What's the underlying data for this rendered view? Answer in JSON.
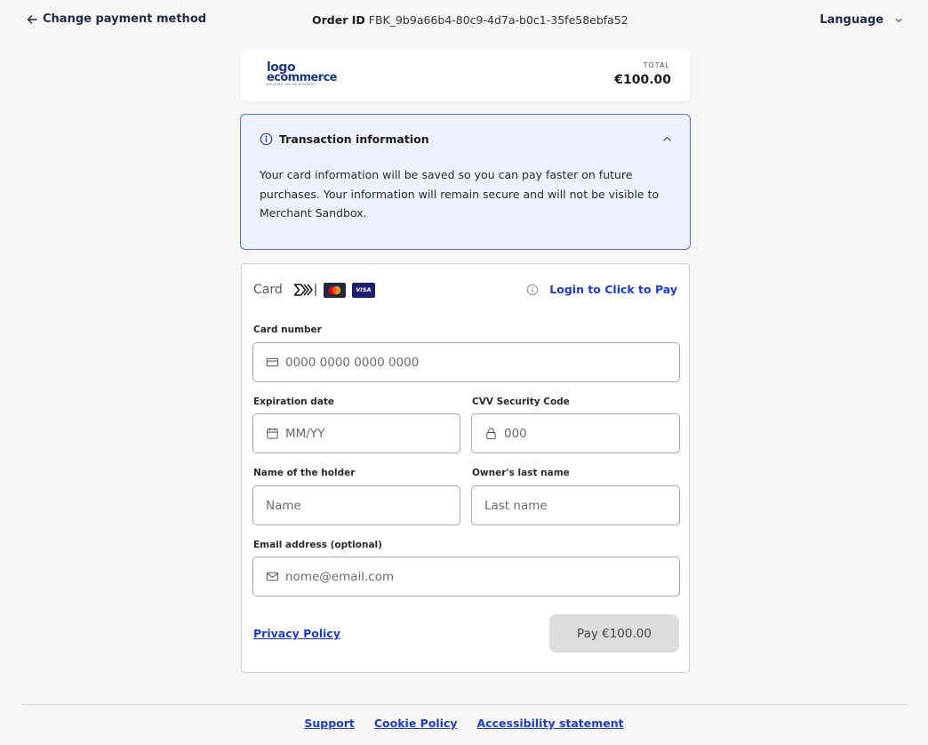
{
  "header": {
    "back_label": "Change payment method",
    "order_label": "Order ID",
    "order_id": "FBK_9b9a66b4-80c9-4d7a-b0c1-35fe58ebfa52",
    "language_label": "Language"
  },
  "merchant": {
    "logo_line1": "logo",
    "logo_line2": "ecommerce",
    "logo_tagline": "BUILDING ONLINE BUSINESS",
    "total_label": "TOTAL",
    "total_value": "€100.00"
  },
  "transaction_info": {
    "title": "Transaction information",
    "body": "Your card information will be saved so you can pay faster on future purchases. Your information will remain secure and will not be visible to Merchant Sandbox."
  },
  "card_form": {
    "title": "Card",
    "visa_text": "VISA",
    "click_to_pay_label": "Login to Click to Pay",
    "card_number_label": "Card number",
    "card_number_placeholder": "0000 0000 0000 0000",
    "expiration_label": "Expiration date",
    "expiration_placeholder": "MM/YY",
    "cvv_label": "CVV Security Code",
    "cvv_placeholder": "000",
    "first_name_label": "Name of the holder",
    "first_name_placeholder": "Name",
    "last_name_label": "Owner's last name",
    "last_name_placeholder": "Last name",
    "email_label": "Email address (optional)",
    "email_placeholder": "nome@email.com",
    "privacy_label": "Privacy Policy",
    "pay_label": "Pay €100.00"
  },
  "footer": {
    "links": [
      "Support",
      "Cookie Policy",
      "Accessibility statement"
    ]
  },
  "colors": {
    "accent_blue": "#1d3bd6",
    "info_border": "#5a6ad8",
    "info_bg": "#eef0fd",
    "pay_button_disabled": "#dcdcdc"
  },
  "icons": [
    "arrow-left-icon",
    "chevron-down-icon",
    "info-icon",
    "chevron-up-icon",
    "click-to-pay-icon",
    "mastercard-icon",
    "visa-icon",
    "credit-card-icon",
    "calendar-icon",
    "lock-icon",
    "mail-icon"
  ]
}
